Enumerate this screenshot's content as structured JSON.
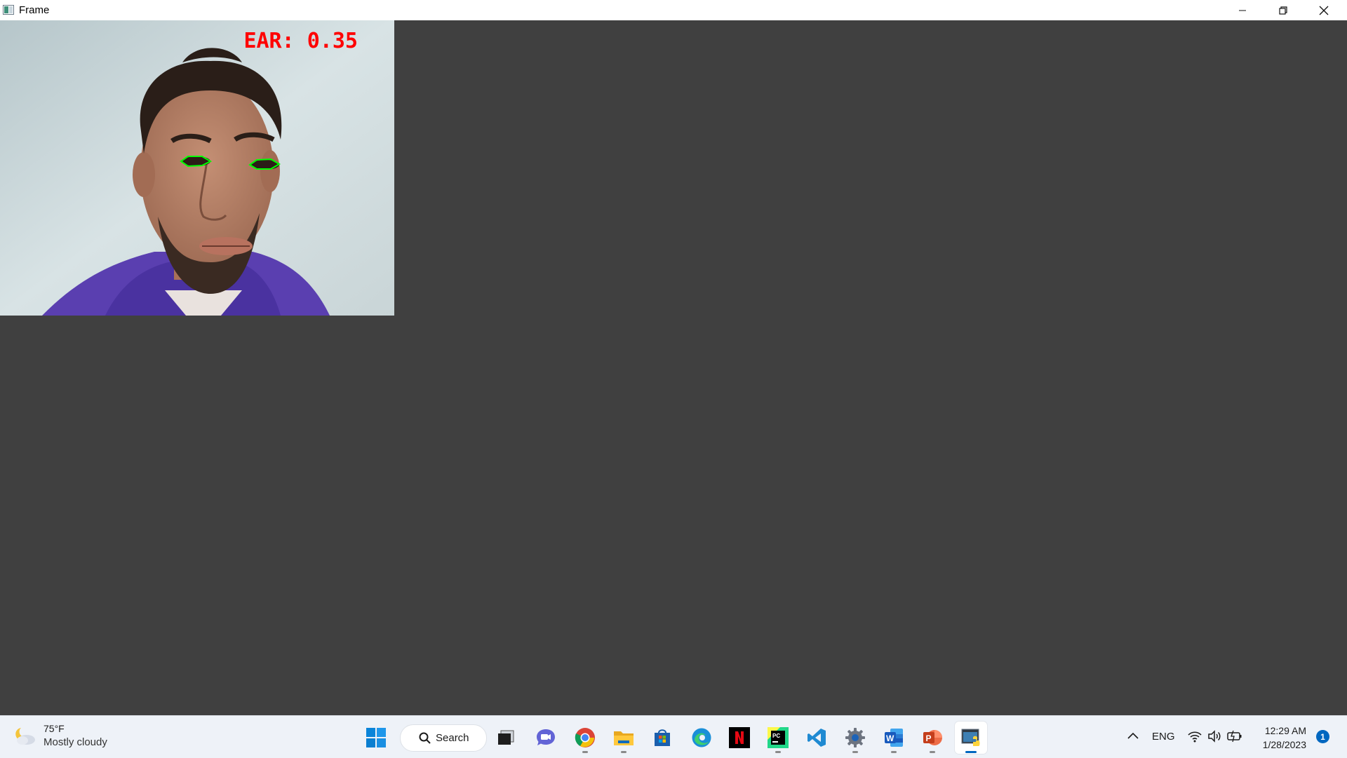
{
  "window": {
    "title": "Frame",
    "controls": [
      "minimize-icon",
      "restore-icon",
      "close-icon"
    ]
  },
  "camera": {
    "ear_label": "EAR: 0.35",
    "eye_contour_color": "#00ff00",
    "ear_text_color": "#ff0000"
  },
  "taskbar": {
    "weather": {
      "temp": "75°F",
      "condition": "Mostly cloudy",
      "icon": "partly-cloudy-moon-icon"
    },
    "search_label": "Search",
    "apps": [
      {
        "name": "start-button",
        "icon": "windows-logo-icon"
      },
      {
        "name": "task-view-button",
        "icon": "task-view-icon"
      },
      {
        "name": "teams-chat-button",
        "icon": "teams-chat-icon"
      },
      {
        "name": "chrome-button",
        "icon": "chrome-icon"
      },
      {
        "name": "file-explorer-button",
        "icon": "folder-icon"
      },
      {
        "name": "microsoft-store-button",
        "icon": "store-icon"
      },
      {
        "name": "edge-button",
        "icon": "edge-icon"
      },
      {
        "name": "netflix-button",
        "icon": "netflix-icon"
      },
      {
        "name": "pycharm-button",
        "icon": "pycharm-icon"
      },
      {
        "name": "vscode-button",
        "icon": "vscode-icon"
      },
      {
        "name": "settings-button",
        "icon": "gear-icon"
      },
      {
        "name": "word-button",
        "icon": "word-icon"
      },
      {
        "name": "powerpoint-button",
        "icon": "powerpoint-icon"
      },
      {
        "name": "python-frame-button",
        "icon": "python-window-icon"
      }
    ],
    "tray": {
      "language": "ENG",
      "time": "12:29 AM",
      "date": "1/28/2023",
      "notification_count": "1"
    }
  },
  "colors": {
    "workspace_bg": "#404040",
    "taskbar_bg": "#eef2f8",
    "accent": "#0067c0"
  }
}
